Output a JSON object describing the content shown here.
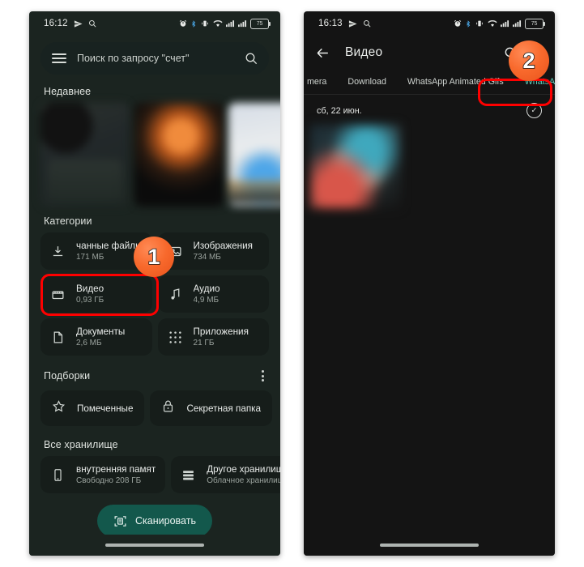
{
  "left_phone": {
    "status_bar": {
      "time": "16:12",
      "icons_left": [
        "send-icon",
        "search-icon"
      ],
      "icons_right": [
        "alarm-icon",
        "bluetooth-icon",
        "vibrate-icon",
        "wifi-icon",
        "signal-icon",
        "signal-icon"
      ],
      "battery_level": "75"
    },
    "search": {
      "placeholder": "Поиск по запросу \"счет\"",
      "menu_icon": "hamburger-icon",
      "search_icon": "search-icon"
    },
    "recent": {
      "title": "Недавнее",
      "thumbnails": [
        "recent-thumb-1",
        "recent-thumb-2",
        "recent-thumb-3"
      ]
    },
    "categories": {
      "title": "Категории",
      "items": [
        {
          "label": "чанные файлы",
          "size": "171 МБ",
          "icon": "download-icon"
        },
        {
          "label": "Изображения",
          "size": "734 МБ",
          "icon": "image-icon"
        },
        {
          "label": "Видео",
          "size": "0,93 ГБ",
          "icon": "video-icon"
        },
        {
          "label": "Аудио",
          "size": "4,9 МБ",
          "icon": "audio-note-icon"
        },
        {
          "label": "Документы",
          "size": "2,6 МБ",
          "icon": "document-icon"
        },
        {
          "label": "Приложения",
          "size": "21 ГБ",
          "icon": "apps-grid-icon"
        }
      ]
    },
    "collections": {
      "title": "Подборки",
      "menu_icon": "kebab-menu-icon",
      "items": [
        {
          "label": "Помеченные",
          "icon": "star-icon"
        },
        {
          "label": "Секретная папка",
          "icon": "lock-icon"
        }
      ]
    },
    "storage": {
      "title": "Все хранилище",
      "items": [
        {
          "label": "внутренняя памят",
          "sub": "Свободно 208 ГБ",
          "icon": "phone-icon"
        },
        {
          "label": "Другое хранилищ",
          "sub": "Облачное хранилищ",
          "icon": "storage-list-icon"
        }
      ]
    },
    "scan_button": {
      "label": "Сканировать",
      "icon": "scan-document-icon"
    }
  },
  "right_phone": {
    "status_bar": {
      "time": "16:13",
      "battery_level": "75"
    },
    "appbar": {
      "back_icon": "back-arrow-icon",
      "title": "Видео",
      "search_icon": "search-icon",
      "view_icon": "list-view-icon"
    },
    "tabs": [
      {
        "label": "mera",
        "active": false
      },
      {
        "label": "Download",
        "active": false
      },
      {
        "label": "WhatsApp Animated Gifs",
        "active": false
      },
      {
        "label": "WhatsApp Video",
        "active": true
      }
    ],
    "date_header": {
      "label": "сб, 22 июн.",
      "select_icon": "check-circle-icon"
    },
    "thumbnail": "video-thumb-1"
  },
  "annotations": {
    "badge_1": "1",
    "badge_2": "2",
    "highlight_color": "#fe0000",
    "badge_color": "#f8692c"
  }
}
